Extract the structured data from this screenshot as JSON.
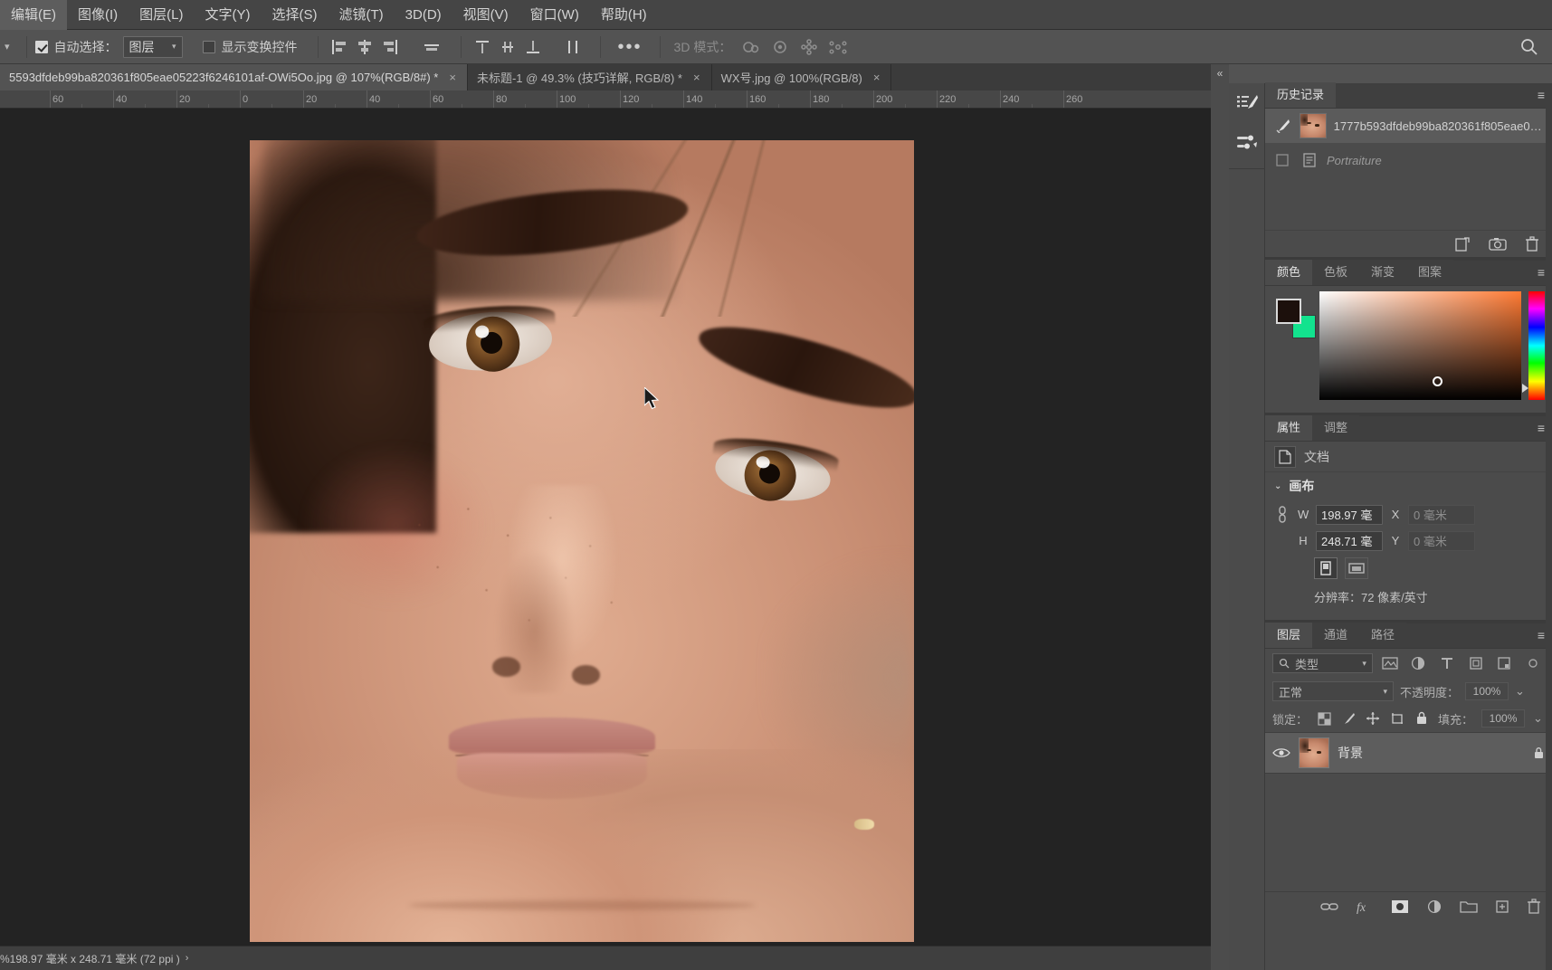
{
  "menu": {
    "items": [
      {
        "label": "编辑(E)"
      },
      {
        "label": "图像(I)"
      },
      {
        "label": "图层(L)"
      },
      {
        "label": "文字(Y)"
      },
      {
        "label": "选择(S)"
      },
      {
        "label": "滤镜(T)"
      },
      {
        "label": "3D(D)"
      },
      {
        "label": "视图(V)"
      },
      {
        "label": "窗口(W)"
      },
      {
        "label": "帮助(H)"
      }
    ]
  },
  "options_bar": {
    "auto_select_label": "自动选择：",
    "auto_select_checked": true,
    "auto_select_value": "图层",
    "show_transform_label": "显示变换控件",
    "show_transform_checked": false,
    "more_label": "•••",
    "mode_3d_label": "3D 模式："
  },
  "tabs": [
    {
      "title": "5593dfdeb99ba820361f805eae05223f6246101af-OWi5Oo.jpg @ 107%(RGB/8#) *",
      "close": "×",
      "active": true
    },
    {
      "title": "未标题-1 @ 49.3% (技巧详解, RGB/8) *",
      "close": "×",
      "active": false
    },
    {
      "title": "WX号.jpg @ 100%(RGB/8)",
      "close": "×",
      "active": false
    }
  ],
  "ruler": {
    "labels": [
      "60",
      "40",
      "20",
      "0",
      "20",
      "40",
      "60",
      "80",
      "100",
      "120",
      "140",
      "160",
      "180",
      "200",
      "220",
      "240",
      "260"
    ]
  },
  "status_bar": {
    "text": "%198.97 毫米 x 248.71 毫米 (72 ppi )",
    "arrow": "›"
  },
  "collapse": {
    "icon": "«"
  },
  "history_panel": {
    "tabs": [
      {
        "label": "历史记录",
        "active": true
      }
    ],
    "menu_icon": "≡",
    "items": [
      {
        "label": "1777b593dfdeb99ba820361f805eae05...",
        "selected": true,
        "dim": false
      },
      {
        "label": "Portraiture",
        "selected": false,
        "dim": true
      }
    ]
  },
  "color_panel": {
    "tabs": [
      {
        "label": "颜色",
        "active": true
      },
      {
        "label": "色板",
        "active": false
      },
      {
        "label": "渐变",
        "active": false
      },
      {
        "label": "图案",
        "active": false
      }
    ],
    "menu_icon": "≡",
    "foreground_color": "#1c100c",
    "background_color": "#12e38e",
    "field_accent": "#ff7a33"
  },
  "properties_panel": {
    "tabs": [
      {
        "label": "属性",
        "active": true
      },
      {
        "label": "调整",
        "active": false
      }
    ],
    "menu_icon": "≡",
    "document_label": "文档",
    "canvas_section_label": "画布",
    "w_label": "W",
    "w_value": "198.97 毫",
    "h_label": "H",
    "h_value": "248.71 毫",
    "x_label": "X",
    "x_value": "0 毫米",
    "y_label": "Y",
    "y_value": "0 毫米",
    "resolution_text": "分辨率：72 像素/英寸"
  },
  "layers_panel": {
    "tabs": [
      {
        "label": "图层",
        "active": true
      },
      {
        "label": "通道",
        "active": false
      },
      {
        "label": "路径",
        "active": false
      }
    ],
    "menu_icon": "≡",
    "filter_placeholder": "类型",
    "blend_mode": "正常",
    "opacity_label": "不透明度：",
    "opacity_value": "100%",
    "lock_label": "锁定：",
    "fill_label": "填充：",
    "fill_value": "100%",
    "layers": [
      {
        "name": "背景",
        "visible": true,
        "locked": true
      }
    ]
  }
}
